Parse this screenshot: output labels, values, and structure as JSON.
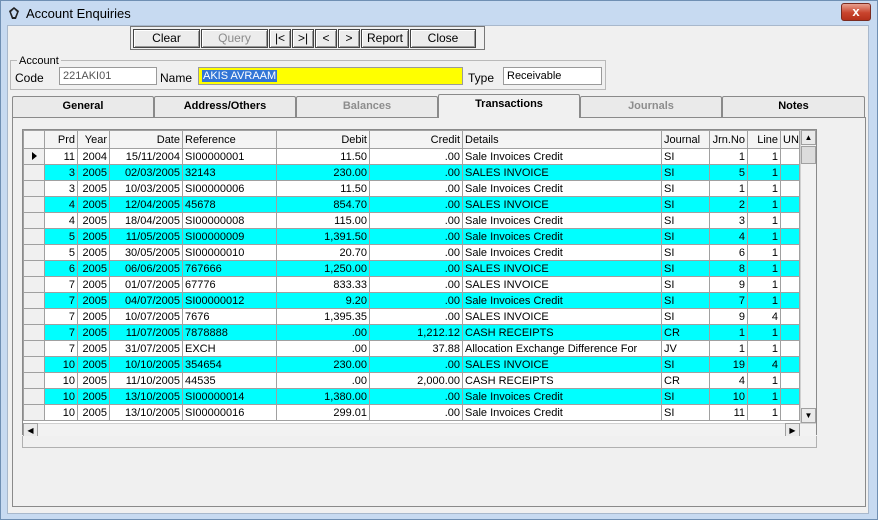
{
  "window": {
    "title": "Account Enquiries",
    "close_label": "x"
  },
  "toolbar": [
    {
      "label": "Clear",
      "enabled": true
    },
    {
      "label": "Query",
      "enabled": false
    },
    {
      "label": "|<",
      "enabled": true
    },
    {
      "label": ">|",
      "enabled": true
    },
    {
      "label": "<",
      "enabled": true
    },
    {
      "label": ">",
      "enabled": true
    },
    {
      "label": "Report",
      "enabled": true
    },
    {
      "label": "Close",
      "enabled": true
    }
  ],
  "account": {
    "legend": "Account",
    "code_label": "Code",
    "code_value": "221AKI01",
    "name_label": "Name",
    "name_value": "AKIS AVRAAM",
    "type_label": "Type",
    "type_value": "Receivable"
  },
  "tabs": [
    {
      "label": "General",
      "state": "normal"
    },
    {
      "label": "Address/Others",
      "state": "normal"
    },
    {
      "label": "Balances",
      "state": "disabled"
    },
    {
      "label": "Transactions",
      "state": "active"
    },
    {
      "label": "Journals",
      "state": "disabled"
    },
    {
      "label": "Notes",
      "state": "normal"
    }
  ],
  "grid": {
    "columns": [
      "Prd",
      "Year",
      "Date",
      "Reference",
      "Debit",
      "Credit",
      "Details",
      "Journal",
      "Jrn.No",
      "Line",
      "UNIT"
    ],
    "rows": [
      {
        "prd": "11",
        "year": "2004",
        "date": "15/11/2004",
        "ref": "SI00000001",
        "debit": "11.50",
        "credit": ".00",
        "details": "Sale Invoices Credit",
        "journal": "SI",
        "jrn": "1",
        "line": "1",
        "highlight": false,
        "current": true
      },
      {
        "prd": "3",
        "year": "2005",
        "date": "02/03/2005",
        "ref": "32143",
        "debit": "230.00",
        "credit": ".00",
        "details": "SALES INVOICE",
        "journal": "SI",
        "jrn": "5",
        "line": "1",
        "highlight": true,
        "current": false
      },
      {
        "prd": "3",
        "year": "2005",
        "date": "10/03/2005",
        "ref": "SI00000006",
        "debit": "11.50",
        "credit": ".00",
        "details": "Sale Invoices Credit",
        "journal": "SI",
        "jrn": "1",
        "line": "1",
        "highlight": false,
        "current": false
      },
      {
        "prd": "4",
        "year": "2005",
        "date": "12/04/2005",
        "ref": "45678",
        "debit": "854.70",
        "credit": ".00",
        "details": "SALES INVOICE",
        "journal": "SI",
        "jrn": "2",
        "line": "1",
        "highlight": true,
        "current": false
      },
      {
        "prd": "4",
        "year": "2005",
        "date": "18/04/2005",
        "ref": "SI00000008",
        "debit": "115.00",
        "credit": ".00",
        "details": "Sale Invoices Credit",
        "journal": "SI",
        "jrn": "3",
        "line": "1",
        "highlight": false,
        "current": false
      },
      {
        "prd": "5",
        "year": "2005",
        "date": "11/05/2005",
        "ref": "SI00000009",
        "debit": "1,391.50",
        "credit": ".00",
        "details": "Sale Invoices Credit",
        "journal": "SI",
        "jrn": "4",
        "line": "1",
        "highlight": true,
        "current": false
      },
      {
        "prd": "5",
        "year": "2005",
        "date": "30/05/2005",
        "ref": "SI00000010",
        "debit": "20.70",
        "credit": ".00",
        "details": "Sale Invoices Credit",
        "journal": "SI",
        "jrn": "6",
        "line": "1",
        "highlight": false,
        "current": false
      },
      {
        "prd": "6",
        "year": "2005",
        "date": "06/06/2005",
        "ref": "767666",
        "debit": "1,250.00",
        "credit": ".00",
        "details": "SALES INVOICE",
        "journal": "SI",
        "jrn": "8",
        "line": "1",
        "highlight": true,
        "current": false
      },
      {
        "prd": "7",
        "year": "2005",
        "date": "01/07/2005",
        "ref": "67776",
        "debit": "833.33",
        "credit": ".00",
        "details": "SALES INVOICE",
        "journal": "SI",
        "jrn": "9",
        "line": "1",
        "highlight": false,
        "current": false
      },
      {
        "prd": "7",
        "year": "2005",
        "date": "04/07/2005",
        "ref": "SI00000012",
        "debit": "9.20",
        "credit": ".00",
        "details": "Sale Invoices Credit",
        "journal": "SI",
        "jrn": "7",
        "line": "1",
        "highlight": true,
        "current": false
      },
      {
        "prd": "7",
        "year": "2005",
        "date": "10/07/2005",
        "ref": "7676",
        "debit": "1,395.35",
        "credit": ".00",
        "details": "SALES INVOICE",
        "journal": "SI",
        "jrn": "9",
        "line": "4",
        "highlight": false,
        "current": false
      },
      {
        "prd": "7",
        "year": "2005",
        "date": "11/07/2005",
        "ref": "7878888",
        "debit": ".00",
        "credit": "1,212.12",
        "details": "CASH RECEIPTS",
        "journal": "CR",
        "jrn": "1",
        "line": "1",
        "highlight": true,
        "current": false
      },
      {
        "prd": "7",
        "year": "2005",
        "date": "31/07/2005",
        "ref": "EXCH",
        "debit": ".00",
        "credit": "37.88",
        "details": "Allocation Exchange Difference For",
        "journal": "JV",
        "jrn": "1",
        "line": "1",
        "highlight": false,
        "current": false
      },
      {
        "prd": "10",
        "year": "2005",
        "date": "10/10/2005",
        "ref": "354654",
        "debit": "230.00",
        "credit": ".00",
        "details": "SALES INVOICE",
        "journal": "SI",
        "jrn": "19",
        "line": "4",
        "highlight": true,
        "current": false
      },
      {
        "prd": "10",
        "year": "2005",
        "date": "11/10/2005",
        "ref": "44535",
        "debit": ".00",
        "credit": "2,000.00",
        "details": "CASH RECEIPTS",
        "journal": "CR",
        "jrn": "4",
        "line": "1",
        "highlight": false,
        "current": false
      },
      {
        "prd": "10",
        "year": "2005",
        "date": "13/10/2005",
        "ref": "SI00000014",
        "debit": "1,380.00",
        "credit": ".00",
        "details": "Sale Invoices Credit",
        "journal": "SI",
        "jrn": "10",
        "line": "1",
        "highlight": true,
        "current": false
      },
      {
        "prd": "10",
        "year": "2005",
        "date": "13/10/2005",
        "ref": "SI00000016",
        "debit": "299.01",
        "credit": ".00",
        "details": "Sale Invoices Credit",
        "journal": "SI",
        "jrn": "11",
        "line": "1",
        "highlight": false,
        "current": false
      }
    ]
  },
  "colors": {
    "highlight_row": "#00ffff",
    "name_field": "#ffff00",
    "selection": "#3375d6",
    "close_button": "#c9442d"
  },
  "icons": {
    "app": "app-logo-icon",
    "scroll_up": "arrow-up-icon",
    "scroll_down": "arrow-down-icon",
    "scroll_left": "arrow-left-icon",
    "scroll_right": "arrow-right-icon",
    "row_pointer": "row-pointer-icon"
  }
}
